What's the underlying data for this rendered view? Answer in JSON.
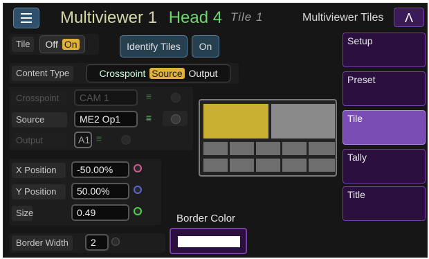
{
  "header": {
    "title": "Multiviewer 1",
    "head": "Head 4",
    "tile": "Tile 1",
    "tiles_label": "Multiviewer Tiles",
    "up_glyph": "Λ"
  },
  "tile_row": {
    "label": "Tile",
    "off": "Off",
    "on": "On",
    "identify": "Identify Tiles",
    "identify_state": "On"
  },
  "content_type": {
    "label": "Content Type",
    "options": [
      "Crosspoint",
      "Source",
      "Output"
    ],
    "selected": "Source"
  },
  "crosspoint": {
    "label": "Crosspoint",
    "value": "CAM 1"
  },
  "source": {
    "label": "Source",
    "value": "ME2 Op1"
  },
  "output": {
    "label": "Output",
    "value": "A1"
  },
  "position": {
    "x_label": "X Position",
    "x_value": "-50.00%",
    "y_label": "Y Position",
    "y_value": "50.00%",
    "size_label": "Size",
    "size_value": "0.49"
  },
  "border": {
    "width_label": "Border Width",
    "width_value": "2",
    "color_label": "Border Color"
  },
  "sidebar": {
    "items": [
      {
        "label": "Setup"
      },
      {
        "label": "Preset"
      },
      {
        "label": "Tile"
      },
      {
        "label": "Tally"
      },
      {
        "label": "Title"
      }
    ],
    "active": "Tile"
  },
  "colors": {
    "accent_green": "#6fd66f",
    "toggle_on": "#e1b23a",
    "tile_highlight": "#c9b033",
    "sidebar_active": "#7a4db5",
    "dot_x": "#d45a9b",
    "dot_y": "#5a64d4",
    "dot_size": "#4fd24f"
  },
  "icons": [
    "list-icon",
    "knob-icon",
    "chevron-up-icon"
  ]
}
